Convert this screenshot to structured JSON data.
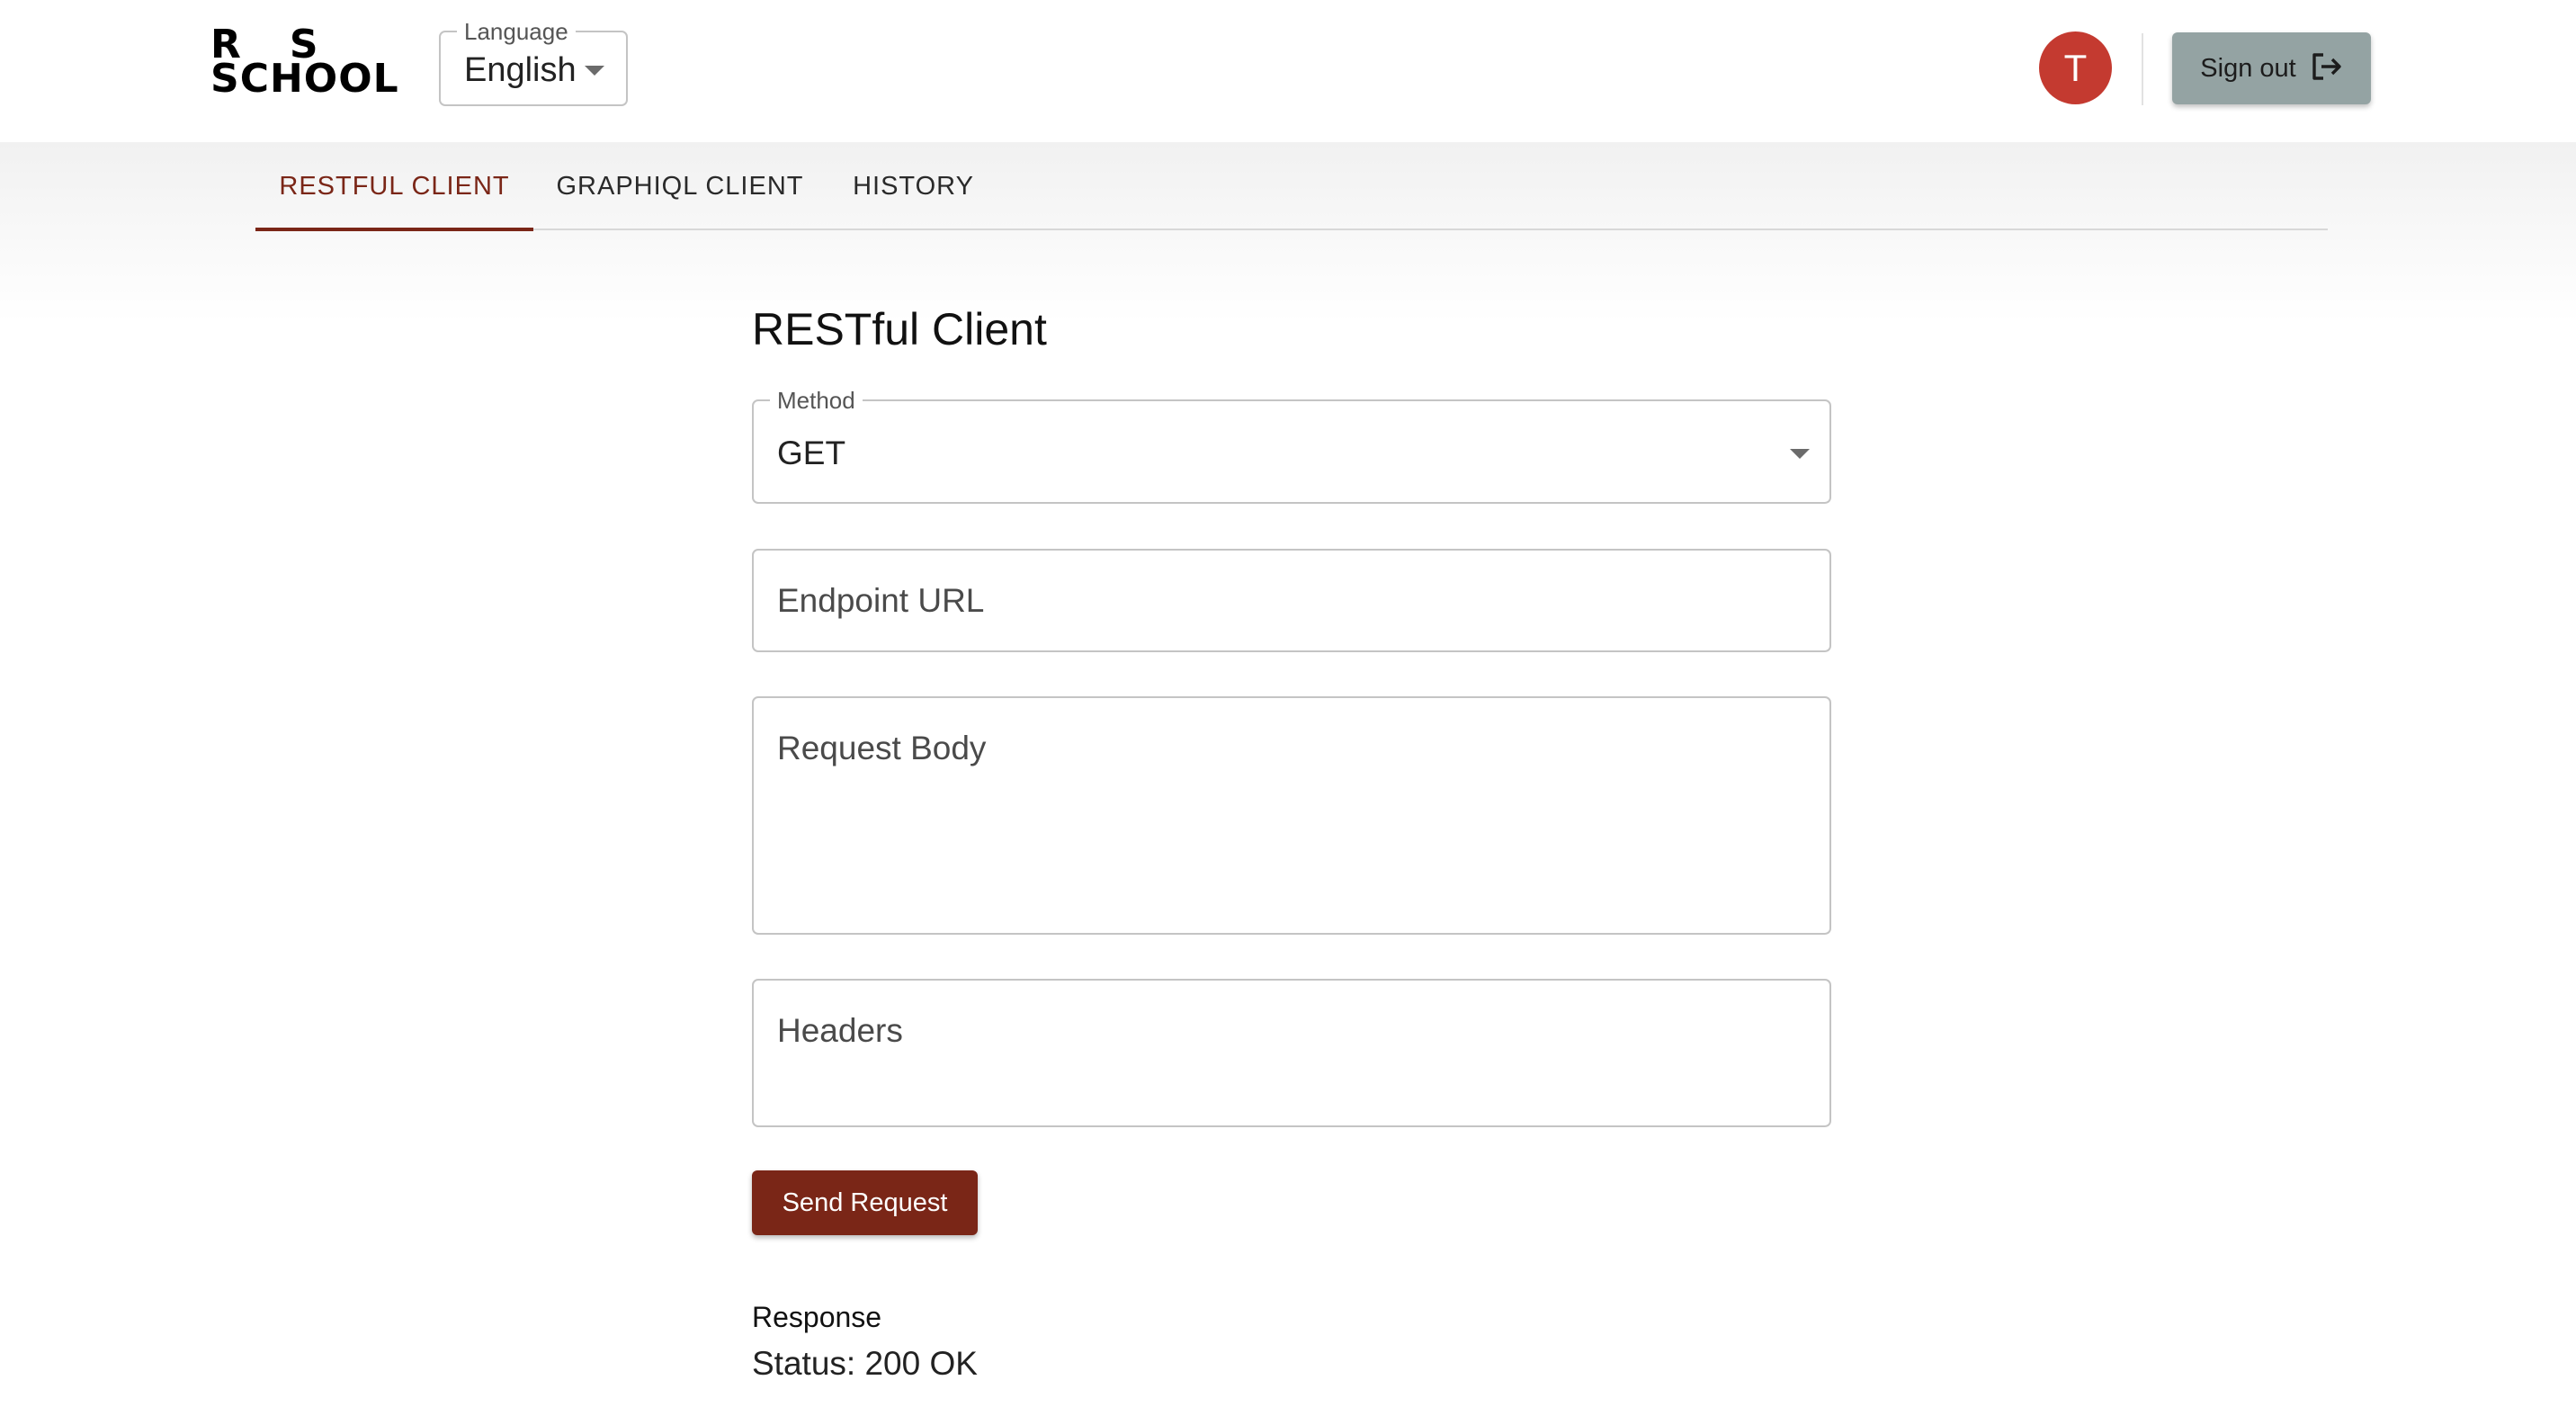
{
  "header": {
    "logo": {
      "line1": "R   S",
      "line2": "SCHOOL"
    },
    "language": {
      "label": "Language",
      "value": "English"
    },
    "user": {
      "initial": "T"
    },
    "sign_out_label": "Sign out"
  },
  "tabs": [
    {
      "label": "RESTFUL CLIENT",
      "active": true
    },
    {
      "label": "GRAPHIQL CLIENT",
      "active": false
    },
    {
      "label": "HISTORY",
      "active": false
    }
  ],
  "main": {
    "title": "RESTful Client",
    "method": {
      "label": "Method",
      "value": "GET"
    },
    "endpoint": {
      "placeholder": "Endpoint URL",
      "value": ""
    },
    "request_body": {
      "placeholder": "Request Body",
      "value": ""
    },
    "headers": {
      "placeholder": "Headers",
      "value": ""
    },
    "send_label": "Send Request",
    "response": {
      "title": "Response",
      "status": "Status: 200 OK"
    }
  },
  "colors": {
    "accent": "#7a2617",
    "avatar": "#c43a30",
    "sign_out_button": "#94a3a3",
    "border": "#c4c4c4"
  },
  "icons": {
    "language_caret": "caret-down-icon",
    "method_caret": "caret-down-icon",
    "sign_out": "logout-icon"
  }
}
